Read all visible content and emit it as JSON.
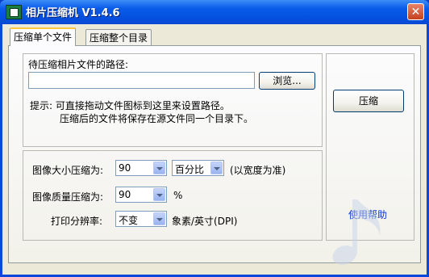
{
  "window": {
    "title": "相片压缩机 V1.4.6",
    "close_label": "✕"
  },
  "tabs": [
    {
      "label": "压缩单个文件",
      "active": true
    },
    {
      "label": "压缩整个目录",
      "active": false
    }
  ],
  "path_group": {
    "label": "待压缩相片文件的路径:",
    "path_value": "",
    "browse_label": "浏览...",
    "hint_line1": "提示: 可直接拖动文件图标到这里来设置路径。",
    "hint_line2": "压缩后的文件将保存在源文件同一个目录下。"
  },
  "options": {
    "size_label": "图像大小压缩为:",
    "size_value": "90",
    "size_unit": "百分比",
    "size_note": "(以宽度为准)",
    "quality_label": "图像质量压缩为:",
    "quality_value": "90",
    "quality_unit": "%",
    "dpi_label": "打印分辨率:",
    "dpi_value": "不变",
    "dpi_unit": "象素/英寸(DPI)"
  },
  "side": {
    "compress_label": "压缩",
    "help_label": "使用帮助"
  },
  "colors": {
    "titlebar": "#0a5ce8",
    "face": "#ece9d8",
    "link": "#0b33d6"
  }
}
